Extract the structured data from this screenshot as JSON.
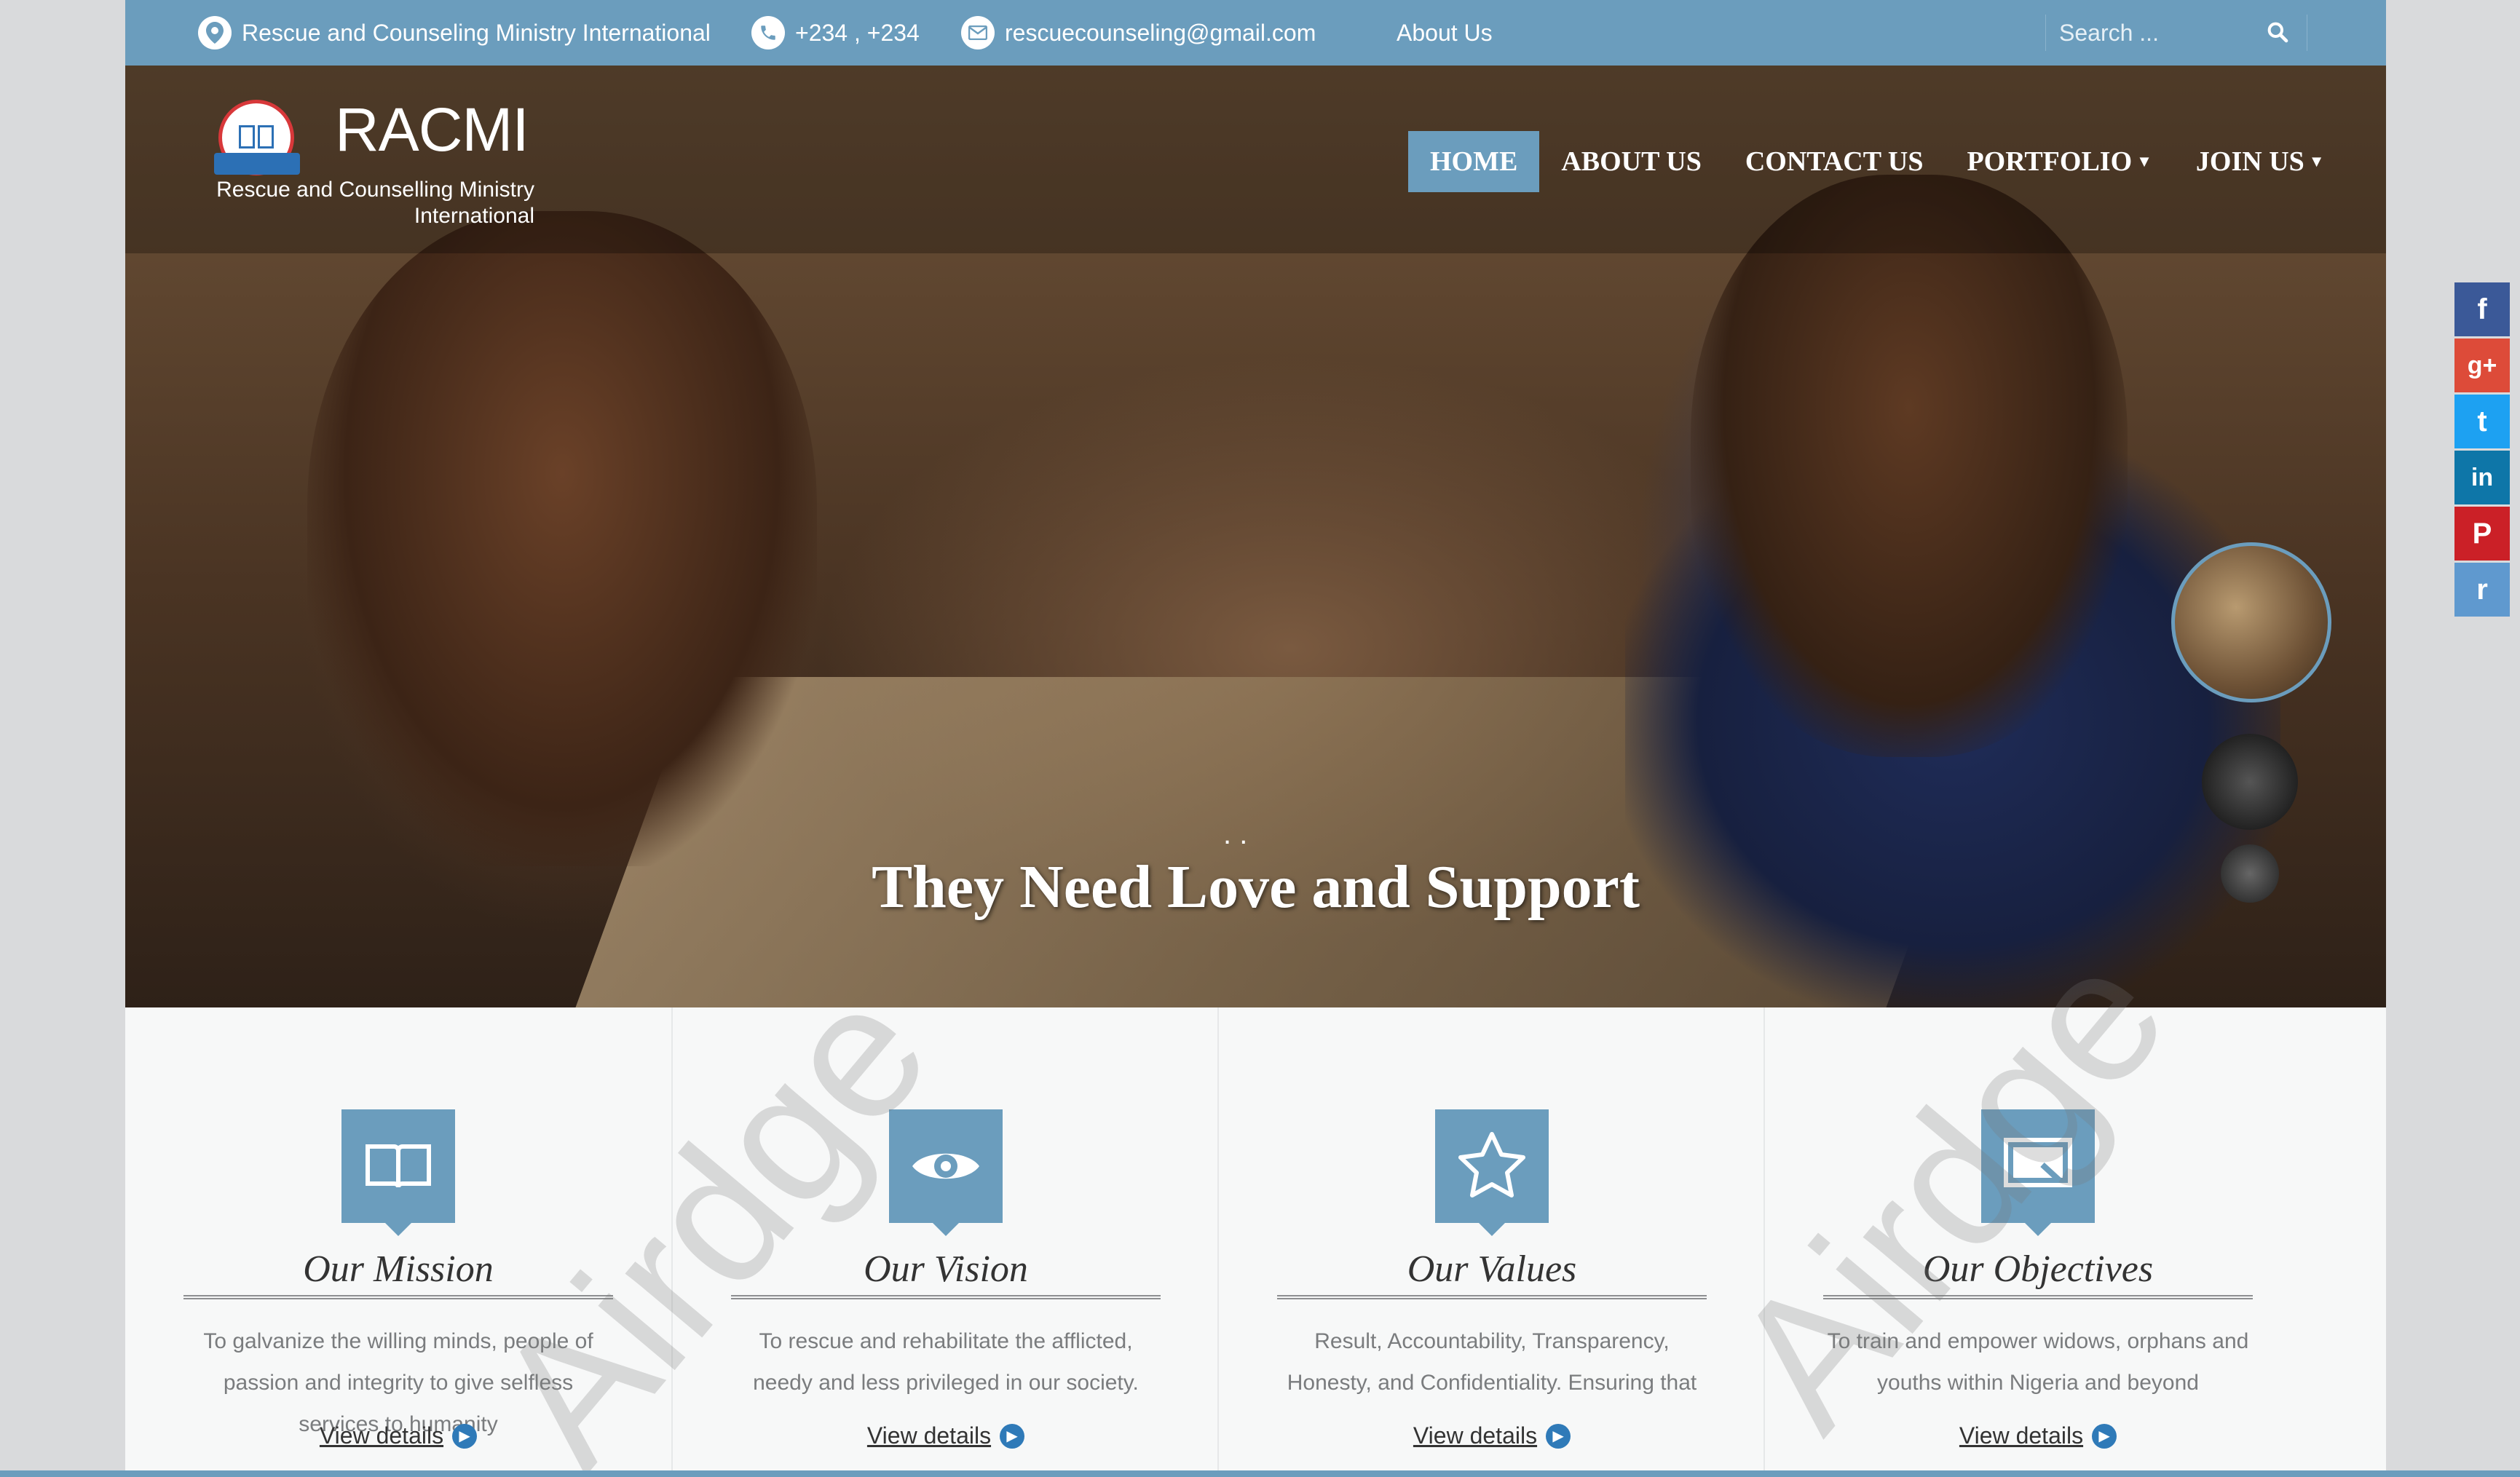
{
  "topbar": {
    "org_name": "Rescue and Counseling Ministry International",
    "phone": "+234 , +234",
    "email": "rescuecounseling@gmail.com",
    "about_link": "About Us",
    "search_placeholder": "Search ..."
  },
  "logo": {
    "title": "RACMI",
    "subtitle_line1": "Rescue and Counselling Ministry",
    "subtitle_line2": "International"
  },
  "nav": [
    {
      "label": "HOME",
      "active": true
    },
    {
      "label": "ABOUT US",
      "active": false
    },
    {
      "label": "CONTACT US",
      "active": false
    },
    {
      "label": "PORTFOLIO",
      "active": false,
      "dropdown": true
    },
    {
      "label": "JOIN US",
      "active": false,
      "dropdown": true
    }
  ],
  "hero": {
    "caption": "They Need Love and Support",
    "dots": ". ."
  },
  "features": [
    {
      "icon": "book-icon",
      "title": "Our Mission",
      "text": "To galvanize the willing minds, people of passion and integrity to give selfless services to humanity",
      "link": "View details"
    },
    {
      "icon": "eye-icon",
      "title": "Our Vision",
      "text": "To rescue and rehabilitate the afflicted, needy and less privileged in our society.",
      "link": "View details"
    },
    {
      "icon": "star-icon",
      "title": "Our Values",
      "text": "Result, Accountability, Transparency, Honesty, and Confidentiality. Ensuring that",
      "link": "View details"
    },
    {
      "icon": "monitor-icon",
      "title": "Our Objectives",
      "text": "To train and empower widows, orphans and youths within Nigeria and beyond",
      "link": "View details"
    }
  ],
  "watermark": "Airdge",
  "social": [
    {
      "icon": "facebook-icon",
      "glyph": "f",
      "color": "#3b5998"
    },
    {
      "icon": "google-plus-icon",
      "glyph": "g+",
      "color": "#dd4b39"
    },
    {
      "icon": "twitter-icon",
      "glyph": "t",
      "color": "#1da1f2"
    },
    {
      "icon": "linkedin-icon",
      "glyph": "in",
      "color": "#0e76a8"
    },
    {
      "icon": "pinterest-icon",
      "glyph": "P",
      "color": "#cb2027"
    },
    {
      "icon": "reddit-icon",
      "glyph": "r",
      "color": "#5f99cf"
    }
  ],
  "colors": {
    "accent": "#6b9dbd",
    "link_arrow": "#2f7ab8"
  }
}
